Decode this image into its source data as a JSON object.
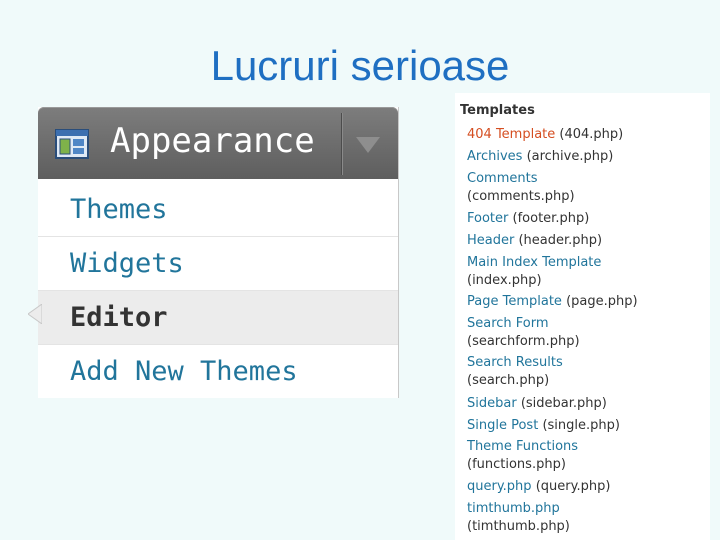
{
  "slide": {
    "title": "Lucruri serioase"
  },
  "menu": {
    "header_label": "Appearance",
    "items": [
      {
        "label": "Themes"
      },
      {
        "label": "Widgets"
      },
      {
        "label": "Editor"
      },
      {
        "label": "Add New Themes"
      }
    ],
    "current": "Editor"
  },
  "templates": {
    "heading": "Templates",
    "items": [
      {
        "name": "404 Template",
        "file": "(404.php)"
      },
      {
        "name": "Archives",
        "file": "(archive.php)"
      },
      {
        "name": "Comments",
        "file": "(comments.php)"
      },
      {
        "name": "Footer",
        "file": "(footer.php)"
      },
      {
        "name": "Header",
        "file": "(header.php)"
      },
      {
        "name": "Main Index Template",
        "file": "(index.php)"
      },
      {
        "name": "Page Template",
        "file": "(page.php)"
      },
      {
        "name": "Search Form",
        "file": "(searchform.php)"
      },
      {
        "name": "Search Results",
        "file": "(search.php)"
      },
      {
        "name": "Sidebar",
        "file": "(sidebar.php)"
      },
      {
        "name": "Single Post",
        "file": "(single.php)"
      },
      {
        "name": "Theme Functions",
        "file": "(functions.php)"
      },
      {
        "name": "query.php",
        "file": "(query.php)"
      },
      {
        "name": "timthumb.php",
        "file": "(timthumb.php)"
      }
    ]
  },
  "colors": {
    "title": "#1f6fc2",
    "link": "#21759b",
    "active_link": "#d54e21",
    "header_bg": "#6b6b6b"
  }
}
